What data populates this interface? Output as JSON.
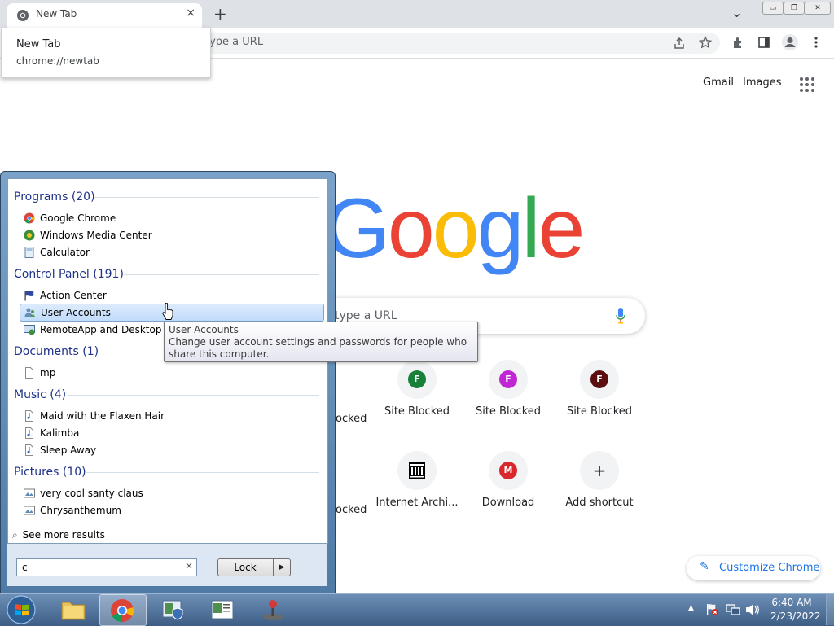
{
  "browser": {
    "tab_title": "New Tab",
    "new_tab_symbol": "+",
    "tab_close_symbol": "×",
    "tab_tooltip": {
      "title": "New Tab",
      "url": "chrome://newtab"
    },
    "omnibox_placeholder": "type a URL",
    "tab_search_symbol": "⌄",
    "window_buttons": {
      "minimize": "▭",
      "restore": "❐",
      "close": "✕"
    }
  },
  "ntp": {
    "top_links": {
      "gmail": "Gmail",
      "images": "Images"
    },
    "logo": {
      "letters": [
        "G",
        "o",
        "o",
        "g",
        "l",
        "e"
      ],
      "colors": [
        "#4285f4",
        "#ea4335",
        "#fbbc05",
        "#4285f4",
        "#34a853",
        "#ea4335"
      ]
    },
    "search_placeholder": "type a URL",
    "shortcuts_row1": [
      {
        "label": "Site Blocked",
        "letter": "F",
        "color": "#188038"
      },
      {
        "label": "Site Blocked",
        "letter": "F",
        "color": "#c026d3"
      },
      {
        "label": "Site Blocked",
        "letter": "F",
        "color": "#5b0f0f"
      }
    ],
    "partial_row1_label": "ocked",
    "partial_row2_label": "ocked",
    "shortcuts_row2": [
      {
        "label": "Internet Archi...",
        "icon": "archive-icon"
      },
      {
        "label": "Download",
        "icon": "mega-icon",
        "letter": "M",
        "color": "#d9272e"
      },
      {
        "label": "Add shortcut",
        "icon": "plus-icon",
        "letter": "+"
      }
    ],
    "customize_label": "Customize Chrome"
  },
  "start_menu": {
    "groups": [
      {
        "title": "Programs (20)",
        "items": [
          "Google Chrome",
          "Windows Media Center",
          "Calculator"
        ]
      },
      {
        "title": "Control Panel (191)",
        "items": [
          "Action Center",
          "User Accounts",
          "RemoteApp and Desktop Co"
        ]
      },
      {
        "title": "Documents (1)",
        "items": [
          "mp"
        ]
      },
      {
        "title": "Music (4)",
        "items": [
          "Maid with the Flaxen Hair",
          "Kalimba",
          "Sleep Away"
        ]
      },
      {
        "title": "Pictures (10)",
        "items": [
          "very cool santy claus",
          "Chrysanthemum"
        ]
      }
    ],
    "see_more": "See more results",
    "search_value": "c",
    "clear_symbol": "×",
    "lock_label": "Lock",
    "lock_arrow": "▶",
    "tooltip": {
      "title": "User Accounts",
      "text": "Change user account settings and passwords for people who share this computer."
    }
  },
  "taskbar": {
    "time": "6:40 AM",
    "date": "2/23/2022",
    "tray_arrow": "▲"
  }
}
